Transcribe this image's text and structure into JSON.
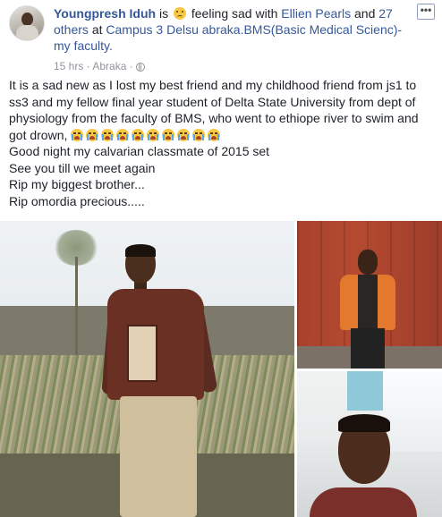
{
  "post": {
    "author": "Youngpresh Iduh",
    "is": "is",
    "feeling": "feeling sad with",
    "tagged_friend": "Ellien Pearls",
    "and": "and",
    "others": "27 others",
    "at": "at",
    "place": "Campus 3 Delsu abraka.BMS(Basic Medical Scienc)-my faculty.",
    "time": "15 hrs",
    "location": "Abraka",
    "privacy_icon": "globe-icon",
    "more_label": "•••",
    "paragraphs": [
      "It is a sad new as I lost my best friend and my childhood friend from js1 to ss3 and my fellow final year student of Delta State University from dept of physiology from the faculty of BMS, who went to ethiope river to swim and got drown,",
      "Good night my calvarian classmate of 2015 set",
      "See you till we meet again",
      "Rip my biggest brother...",
      "Rip omordia precious....."
    ],
    "crying_emoji_count": 10
  },
  "colors": {
    "link": "#365899",
    "text": "#1d2129",
    "meta": "#90949c"
  }
}
